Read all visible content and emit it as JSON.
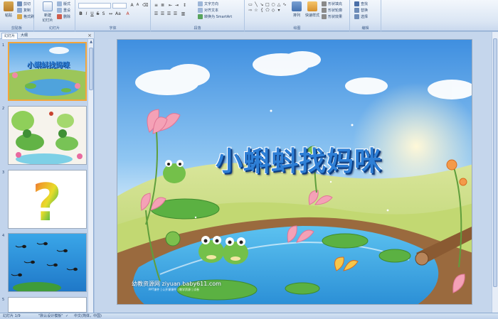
{
  "ribbon": {
    "clipboard": {
      "paste": "粘贴",
      "cut": "剪切",
      "copy": "复制",
      "format_painter": "格式刷",
      "label": "剪贴板"
    },
    "slides": {
      "new_slide": "新建\n幻灯片",
      "layout": "版式",
      "reset": "重设",
      "delete": "删除",
      "label": "幻灯片"
    },
    "font": {
      "font_name": "",
      "font_size": "",
      "label": "字体"
    },
    "paragraph": {
      "text_direction": "文字方向",
      "align_text": "对齐文本",
      "smartart": "转换为 SmartArt",
      "label": "段落"
    },
    "drawing": {
      "arrange": "排列",
      "quick_styles": "快速样式",
      "shape_fill": "形状填充",
      "shape_outline": "形状轮廓",
      "shape_effects": "形状效果",
      "label": "绘图"
    },
    "editing": {
      "find": "查找",
      "replace": "替换",
      "select": "选择",
      "label": "编辑"
    }
  },
  "panel": {
    "tab_slides": "幻灯片",
    "tab_outline": "大纲",
    "close": "×",
    "slide_numbers": [
      "1",
      "2",
      "3",
      "4",
      "5"
    ]
  },
  "slide": {
    "title": "小蝌蚪找妈咪",
    "watermark": "幼教资源网 ziyuan.baby611.com",
    "watermark_small": "PPT课件 | 公开课课件 | 教学资源 | 试卷"
  },
  "thumbs": {
    "thumb1_title": "小蝌蚪找妈咪",
    "thumb3_glyph": "?"
  },
  "status": {
    "slide_info": "幻灯片 1/9",
    "theme": "\"默认设计模板\"",
    "language": "中文(简体，中国)"
  },
  "colors": {
    "ribbon_bg": "#dbe6f4",
    "panel_bg": "#c2d4ec",
    "title_blue": "#2e7fd6",
    "selected_border": "#f3a53a"
  }
}
